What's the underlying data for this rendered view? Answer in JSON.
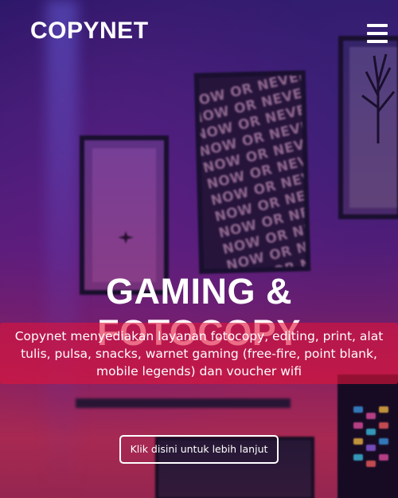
{
  "navbar": {
    "brand": "COPYNET",
    "menu_icon": "hamburger-menu-icon"
  },
  "hero": {
    "title": "GAMING & FOTOCOPY",
    "description": "Copynet menyediakan layanan fotocopy, editing, print, alat tulis, pulsa, snacks, warnet gaming (free-fire, point blank, mobile legends) dan voucher wifi",
    "cta_label": "Klik disini untuk lebih lanjut",
    "background_poster_text": [
      "NOW OR NEVER",
      "NOW OR NEVER",
      "NOW OR NEVER",
      "NOW OR NEVER",
      "NOW OR NEVER",
      "NOW OR NEVER",
      "NOW OR NEVER",
      "NOW OR NEVER",
      "NOW OR NEVER",
      "NOW OR NEVER",
      "NOW OR NEVER",
      "NOW OR NEVER"
    ]
  },
  "colors": {
    "description_band": "#e1143c",
    "text": "#ffffff"
  }
}
